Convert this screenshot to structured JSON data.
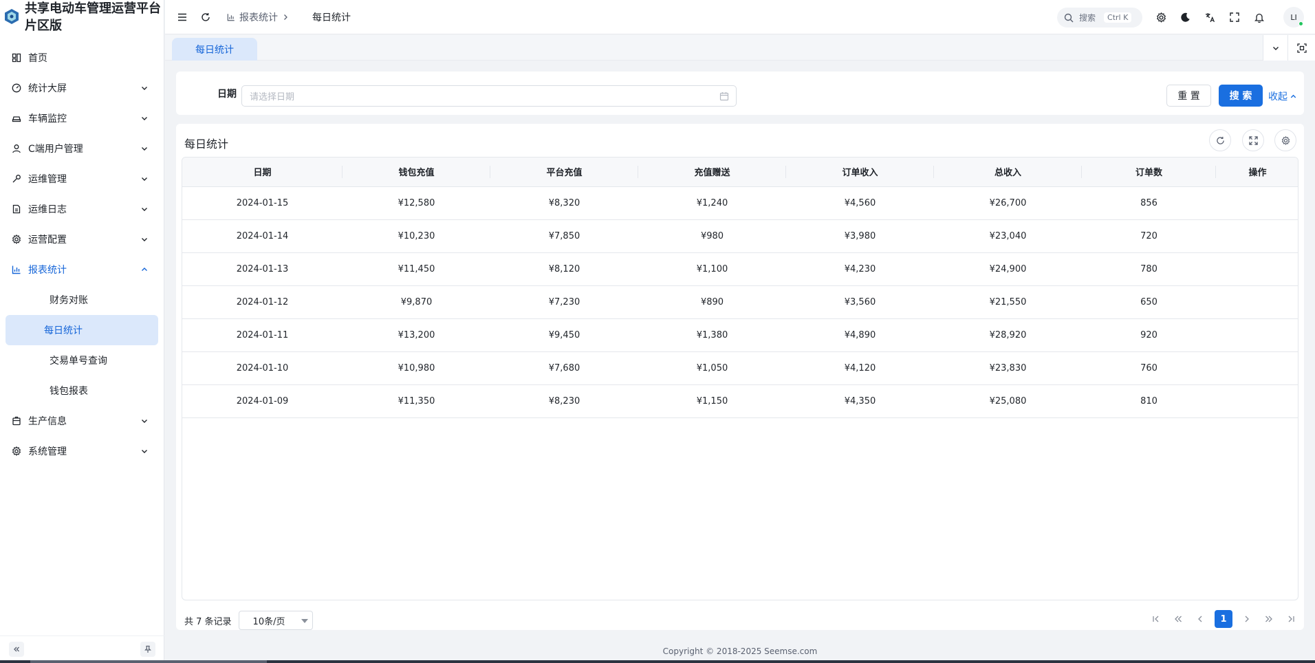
{
  "brand": {
    "title_line1": "共享电动车管理运营平台",
    "title_line2": "片区版"
  },
  "sidebar": {
    "items": [
      {
        "label": "首页",
        "icon": "home-icon",
        "has_chevron": false
      },
      {
        "label": "统计大屏",
        "icon": "dashboard-icon",
        "has_chevron": true
      },
      {
        "label": "车辆监控",
        "icon": "car-icon",
        "has_chevron": true
      },
      {
        "label": "C端用户管理",
        "icon": "user-icon",
        "has_chevron": true
      },
      {
        "label": "运维管理",
        "icon": "wrench-icon",
        "has_chevron": true
      },
      {
        "label": "运维日志",
        "icon": "document-icon",
        "has_chevron": true
      },
      {
        "label": "运营配置",
        "icon": "gear-icon",
        "has_chevron": true
      },
      {
        "label": "报表统计",
        "icon": "bar-chart-icon",
        "has_chevron": true,
        "expanded": true
      },
      {
        "label": "生产信息",
        "icon": "box-icon",
        "has_chevron": true
      },
      {
        "label": "系统管理",
        "icon": "gear-icon",
        "has_chevron": true
      }
    ],
    "report_subitems": [
      "财务对账",
      "每日统计",
      "交易单号查询",
      "钱包报表"
    ],
    "selected_subitem": "每日统计"
  },
  "header": {
    "breadcrumb_parent": "报表统计",
    "breadcrumb_current": "每日统计",
    "search_placeholder": "搜索",
    "search_shortcut": "Ctrl K",
    "avatar_text": "LI"
  },
  "tabs": [
    {
      "label": "每日统计",
      "active": true
    }
  ],
  "filter": {
    "date_label": "日期",
    "date_placeholder": "请选择日期",
    "reset_label": "重 置",
    "search_label": "搜 索",
    "collapse_label": "收起"
  },
  "table": {
    "title": "每日统计",
    "columns": [
      "日期",
      "钱包充值",
      "平台充值",
      "充值赠送",
      "订单收入",
      "总收入",
      "订单数",
      "操作"
    ],
    "rows": [
      [
        "2024-01-15",
        "¥12,580",
        "¥8,320",
        "¥1,240",
        "¥4,560",
        "¥26,700",
        "856",
        ""
      ],
      [
        "2024-01-14",
        "¥10,230",
        "¥7,850",
        "¥980",
        "¥3,980",
        "¥23,040",
        "720",
        ""
      ],
      [
        "2024-01-13",
        "¥11,450",
        "¥8,120",
        "¥1,100",
        "¥4,230",
        "¥24,900",
        "780",
        ""
      ],
      [
        "2024-01-12",
        "¥9,870",
        "¥7,230",
        "¥890",
        "¥3,560",
        "¥21,550",
        "650",
        ""
      ],
      [
        "2024-01-11",
        "¥13,200",
        "¥9,450",
        "¥1,380",
        "¥4,890",
        "¥28,920",
        "920",
        ""
      ],
      [
        "2024-01-10",
        "¥10,980",
        "¥7,680",
        "¥1,050",
        "¥4,120",
        "¥23,830",
        "760",
        ""
      ],
      [
        "2024-01-09",
        "¥11,350",
        "¥8,230",
        "¥1,150",
        "¥4,350",
        "¥25,080",
        "810",
        ""
      ]
    ]
  },
  "pagination": {
    "total_text": "共 7 条记录",
    "page_size": "10条/页",
    "current_page": "1"
  },
  "footer": {
    "copyright": "Copyright © 2018-2025 Seemse.com"
  },
  "colors": {
    "primary": "#1a6fe0",
    "selected_bg": "#dbe8fb",
    "page_bg": "#f1f3f6"
  }
}
